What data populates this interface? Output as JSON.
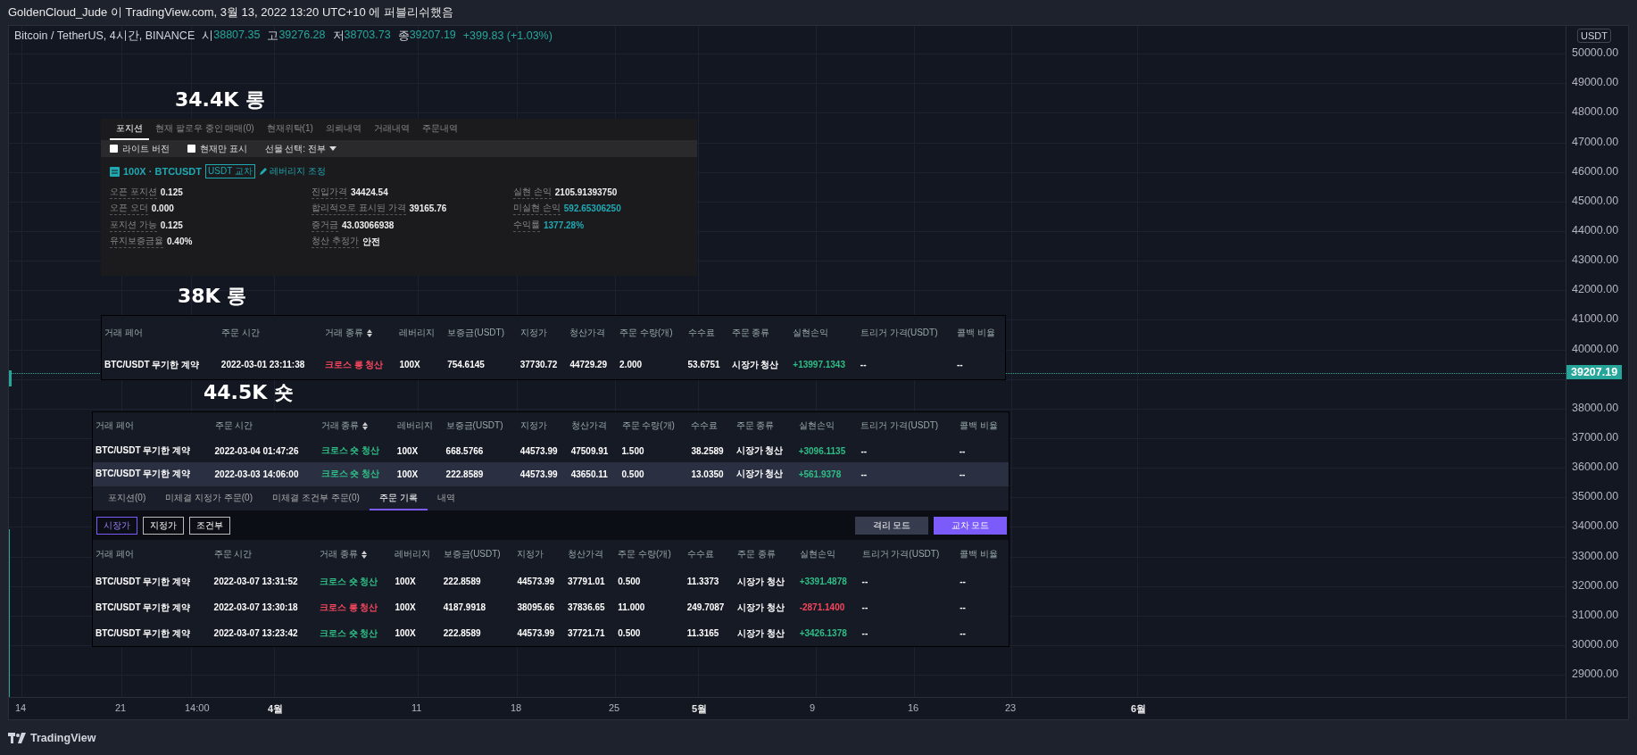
{
  "header": {
    "title": "GoldenCloud_Jude 이 TradingView.com, 3월 13, 2022 13:20 UTC+10 에 퍼블리쉬했음"
  },
  "legend": {
    "symbol": "Bitcoin / TetherUS, 4시간, BINANCE",
    "values": [
      {
        "label": "시",
        "value": "38807.35"
      },
      {
        "label": "고",
        "value": "39276.28"
      },
      {
        "label": "저",
        "value": "38703.73"
      },
      {
        "label": "종",
        "value": "39207.19"
      }
    ],
    "change": "+399.83 (+1.03%)"
  },
  "price_axis": {
    "currency": "USDT",
    "ticks": [
      "50000.00",
      "49000.00",
      "48000.00",
      "47000.00",
      "46000.00",
      "45000.00",
      "44000.00",
      "43000.00",
      "42000.00",
      "41000.00",
      "40000.00",
      "38000.00",
      "37000.00",
      "36000.00",
      "35000.00",
      "34000.00",
      "33000.00",
      "32000.00",
      "31000.00",
      "30000.00",
      "29000.00"
    ],
    "last_price": "39207.19"
  },
  "time_axis": {
    "ticks": [
      {
        "label": "14",
        "major": false
      },
      {
        "label": "21",
        "major": false
      },
      {
        "label": "14:00",
        "major": false
      },
      {
        "label": "4월",
        "major": true
      },
      {
        "label": "11",
        "major": false
      },
      {
        "label": "18",
        "major": false
      },
      {
        "label": "25",
        "major": false
      },
      {
        "label": "5월",
        "major": true
      },
      {
        "label": "9",
        "major": false
      },
      {
        "label": "16",
        "major": false
      },
      {
        "label": "23",
        "major": false
      },
      {
        "label": "6월",
        "major": true
      }
    ]
  },
  "snapshots": [
    {
      "caption": "34.4K 롱",
      "kind": "position",
      "tabs": [
        {
          "label": "포지션",
          "selected": true
        },
        {
          "label": "현재 팔로우 중인 매매(0)",
          "selected": false
        },
        {
          "label": "현재위탁(1)",
          "selected": false
        },
        {
          "label": "의뢰내역",
          "selected": false
        },
        {
          "label": "거래내역",
          "selected": false
        },
        {
          "label": "주문내역",
          "selected": false
        }
      ],
      "filters": [
        {
          "label": "라이트 버전",
          "checked": false
        },
        {
          "label": "현재만 표시",
          "checked": false
        }
      ],
      "dropdown": "선물 선택: 전부",
      "position": {
        "title": "100X · BTCUSDT",
        "badge": "USDT 교차",
        "link": "레버리지 조정",
        "fields": [
          [
            {
              "label": "오픈 포지션",
              "value": "0.125",
              "highlight": false
            },
            {
              "label": "오픈 오더",
              "value": "0.000",
              "highlight": false
            },
            {
              "label": "포지션 가능",
              "value": "0.125",
              "highlight": false
            },
            {
              "label": "유지보증금율",
              "value": "0.40%",
              "highlight": false
            }
          ],
          [
            {
              "label": "진입가격",
              "value": "34424.54",
              "highlight": false
            },
            {
              "label": "합리적으로 표시된 가격",
              "value": "39165.76",
              "highlight": false
            },
            {
              "label": "증거금",
              "value": "43.03066938",
              "highlight": false
            },
            {
              "label": "청산 추정가",
              "value": "안전",
              "highlight": false
            }
          ],
          [
            {
              "label": "실현 손익",
              "value": "2105.91393750",
              "highlight": false
            },
            {
              "label": "미실현 손익",
              "value": "592.65306250",
              "highlight": true
            },
            {
              "label": "수익률",
              "value": "1377.28%",
              "highlight": true
            }
          ]
        ]
      }
    },
    {
      "caption": "38K 롱",
      "kind": "table",
      "table": {
        "columns": [
          {
            "label": "거래 페어",
            "sortable": false
          },
          {
            "label": "주문 시간",
            "sortable": false
          },
          {
            "label": "거래 종류",
            "sortable": true
          },
          {
            "label": "레버리지",
            "sortable": false
          },
          {
            "label": "보증금(USDT)",
            "sortable": false
          },
          {
            "label": "지정가",
            "sortable": false
          },
          {
            "label": "청산가격",
            "sortable": false
          },
          {
            "label": "주문 수량(개)",
            "sortable": false
          },
          {
            "label": "수수료",
            "sortable": false
          },
          {
            "label": "주문 종류",
            "sortable": false
          },
          {
            "label": "실현손익",
            "sortable": false
          },
          {
            "label": "트리거 가격(USDT)",
            "sortable": false
          },
          {
            "label": "콜백 비율",
            "sortable": false
          }
        ],
        "rows": [
          {
            "kind": "long",
            "profit": true,
            "highlighted": false,
            "cells": [
              "BTC/USDT 무기한 계약",
              "2022-03-01 23:11:38",
              "크로스 롱 청산",
              "100X",
              "754.6145",
              "37730.72",
              "44729.29",
              "2.000",
              "53.6751",
              "시장가 청산",
              "+13997.1343",
              "--",
              "--"
            ]
          }
        ]
      }
    },
    {
      "caption": "44.5K 숏",
      "kind": "table",
      "table": {
        "columns": [
          {
            "label": "거래 페어",
            "sortable": false
          },
          {
            "label": "주문 시간",
            "sortable": false
          },
          {
            "label": "거래 종류",
            "sortable": true
          },
          {
            "label": "레버리지",
            "sortable": false
          },
          {
            "label": "보증금(USDT)",
            "sortable": false
          },
          {
            "label": "지정가",
            "sortable": false
          },
          {
            "label": "청산가격",
            "sortable": false
          },
          {
            "label": "주문 수량(개)",
            "sortable": false
          },
          {
            "label": "수수료",
            "sortable": false
          },
          {
            "label": "주문 종류",
            "sortable": false
          },
          {
            "label": "실현손익",
            "sortable": false
          },
          {
            "label": "트리거 가격(USDT)",
            "sortable": false
          },
          {
            "label": "콜백 비율",
            "sortable": false
          }
        ],
        "rows": [
          {
            "kind": "short",
            "profit": true,
            "highlighted": false,
            "cells": [
              "BTC/USDT 무기한 계약",
              "2022-03-04 01:47:26",
              "크로스 숏 청산",
              "100X",
              "668.5766",
              "44573.99",
              "47509.91",
              "1.500",
              "38.2589",
              "시장가 청산",
              "+3096.1135",
              "--",
              "--"
            ]
          },
          {
            "kind": "short",
            "profit": true,
            "highlighted": true,
            "cells": [
              "BTC/USDT 무기한 계약",
              "2022-03-03 14:06:00",
              "크로스 숏 청산",
              "100X",
              "222.8589",
              "44573.99",
              "43650.11",
              "0.500",
              "13.0350",
              "시장가 청산",
              "+561.9378",
              "--",
              "--"
            ]
          }
        ]
      }
    },
    {
      "kind": "history",
      "tabs": [
        {
          "label": "포지션(0)",
          "selected": false
        },
        {
          "label": "미체결 지정가 주문(0)",
          "selected": false
        },
        {
          "label": "미체결 조건부 주문(0)",
          "selected": false
        },
        {
          "label": "주문 기록",
          "selected": true
        },
        {
          "label": "내역",
          "selected": false
        }
      ],
      "order_types": [
        {
          "label": "시장가",
          "selected": true
        },
        {
          "label": "지정가",
          "selected": false
        },
        {
          "label": "조건부",
          "selected": false
        }
      ],
      "modes": [
        {
          "label": "격리 모드",
          "selected": false
        },
        {
          "label": "교차 모드",
          "selected": true
        }
      ],
      "table": {
        "columns": [
          {
            "label": "거래 페어",
            "sortable": false
          },
          {
            "label": "주문 시간",
            "sortable": false
          },
          {
            "label": "거래 종류",
            "sortable": true
          },
          {
            "label": "레버리지",
            "sortable": false
          },
          {
            "label": "보증금(USDT)",
            "sortable": false
          },
          {
            "label": "지정가",
            "sortable": false
          },
          {
            "label": "청산가격",
            "sortable": false
          },
          {
            "label": "주문 수량(개)",
            "sortable": false
          },
          {
            "label": "수수료",
            "sortable": false
          },
          {
            "label": "주문 종류",
            "sortable": false
          },
          {
            "label": "실현손익",
            "sortable": false
          },
          {
            "label": "트리거 가격(USDT)",
            "sortable": false
          },
          {
            "label": "콜백 비율",
            "sortable": false
          }
        ],
        "rows": [
          {
            "kind": "short",
            "profit": true,
            "highlighted": false,
            "cells": [
              "BTC/USDT 무기한 계약",
              "2022-03-07 13:31:52",
              "크로스 숏 청산",
              "100X",
              "222.8589",
              "44573.99",
              "37791.01",
              "0.500",
              "11.3373",
              "시장가 청산",
              "+3391.4878",
              "--",
              "--"
            ]
          },
          {
            "kind": "long",
            "profit": false,
            "highlighted": false,
            "cells": [
              "BTC/USDT 무기한 계약",
              "2022-03-07 13:30:18",
              "크로스 롱 청산",
              "100X",
              "4187.9918",
              "38095.66",
              "37836.65",
              "11.000",
              "249.7087",
              "시장가 청산",
              "-2871.1400",
              "--",
              "--"
            ]
          },
          {
            "kind": "short",
            "profit": true,
            "highlighted": false,
            "cells": [
              "BTC/USDT 무기한 계약",
              "2022-03-07 13:23:42",
              "크로스 숏 청산",
              "100X",
              "222.8589",
              "44573.99",
              "37721.71",
              "0.500",
              "11.3165",
              "시장가 청산",
              "+3426.1378",
              "--",
              "--"
            ]
          }
        ]
      }
    }
  ],
  "footer": {
    "brand": "TradingView"
  }
}
